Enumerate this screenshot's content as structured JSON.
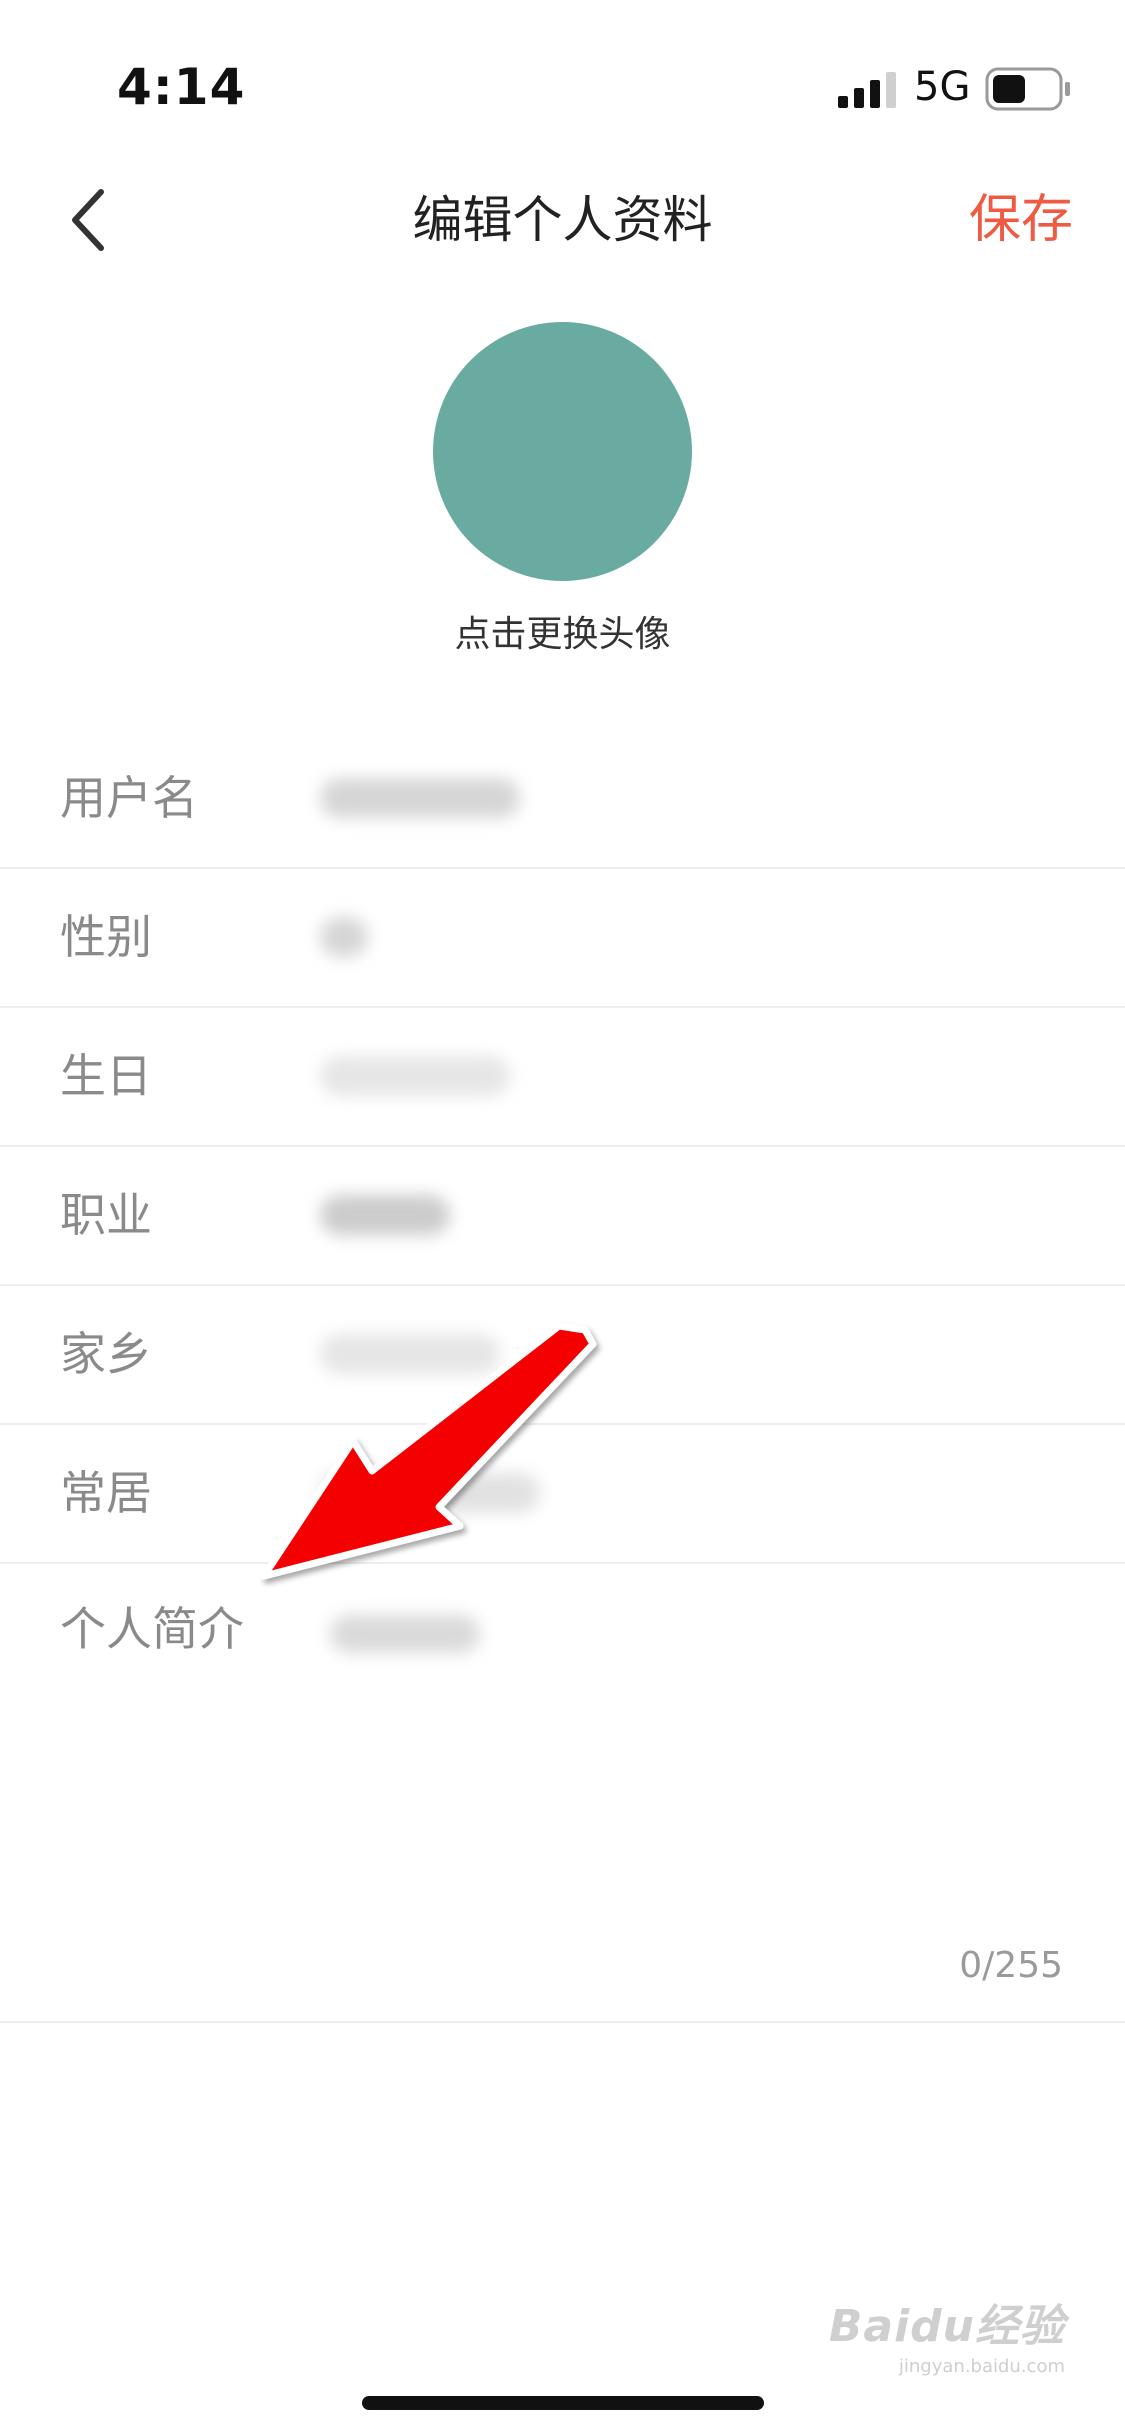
{
  "status_bar": {
    "time": "4:14",
    "network": "5G",
    "signal_icon": "signal-bars-icon",
    "battery_icon": "battery-icon"
  },
  "nav": {
    "back_icon": "chevron-left-icon",
    "title": "编辑个人资料",
    "save_label": "保存",
    "save_color": "#ee5a42"
  },
  "avatar": {
    "hint": "点击更换头像",
    "color": "#6aaba1"
  },
  "form": {
    "rows": [
      {
        "label": "用户名"
      },
      {
        "label": "性别"
      },
      {
        "label": "生日"
      },
      {
        "label": "职业"
      },
      {
        "label": "家乡"
      },
      {
        "label": "常居"
      }
    ],
    "bio": {
      "label": "个人简介",
      "counter": "0/255"
    }
  },
  "annotation": {
    "icon": "red-arrow-icon",
    "color": "#ff0000"
  },
  "watermark": {
    "main": "Baidu经验",
    "sub": "jingyan.baidu.com"
  }
}
